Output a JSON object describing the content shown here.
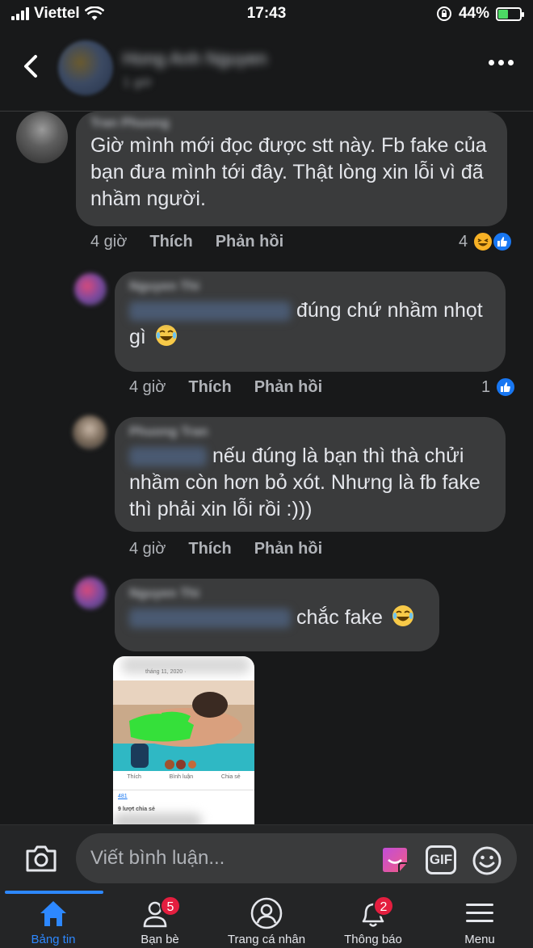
{
  "status_bar": {
    "carrier": "Viettel",
    "time": "17:43",
    "battery": "44%"
  },
  "header": {
    "name": "Hong Anh Nguyen",
    "subtitle": "1 giờ"
  },
  "comments": [
    {
      "author": "Tran Phuong",
      "text": "Giờ mình mới đọc được stt này. Fb fake của bạn đưa mình tới đây. Thật lòng xin lỗi vì đã nhầm người.",
      "time": "4 giờ",
      "like": "Thích",
      "reply": "Phản hồi",
      "reaction_count": "4"
    },
    {
      "author": "Nguyen Thi",
      "text": "đúng chứ nhầm nhọt gì",
      "time": "4 giờ",
      "like": "Thích",
      "reply": "Phản hồi",
      "reaction_count": "1"
    },
    {
      "author": "Phuong Tran",
      "text": "nếu đúng là bạn thì thà chửi nhầm còn hơn bỏ xót. Nhưng là fb fake thì phải xin lỗi rồi :)))",
      "time": "4 giờ",
      "like": "Thích",
      "reply": "Phản hồi"
    },
    {
      "author": "Nguyen Thi",
      "text": "chắc fake"
    }
  ],
  "attachment": {
    "date": "tháng 11, 2020 ·",
    "actions": [
      "Thích",
      "Bình luận",
      "Chia sẻ"
    ],
    "reactions": "481",
    "shares": "9 lượt chia sẻ"
  },
  "composer": {
    "placeholder": "Viết bình luận...",
    "gif_label": "GIF"
  },
  "tabs": [
    {
      "label": "Bảng tin",
      "icon": "home-icon"
    },
    {
      "label": "Bạn bè",
      "icon": "friends-icon",
      "badge": "5"
    },
    {
      "label": "Trang cá nhân",
      "icon": "profile-icon"
    },
    {
      "label": "Thông báo",
      "icon": "bell-icon",
      "badge": "2"
    },
    {
      "label": "Menu",
      "icon": "menu-icon"
    }
  ],
  "colors": {
    "background": "#18191a",
    "bubble": "#3a3b3c",
    "accent": "#2d88ff",
    "badge": "#e41e3f"
  }
}
